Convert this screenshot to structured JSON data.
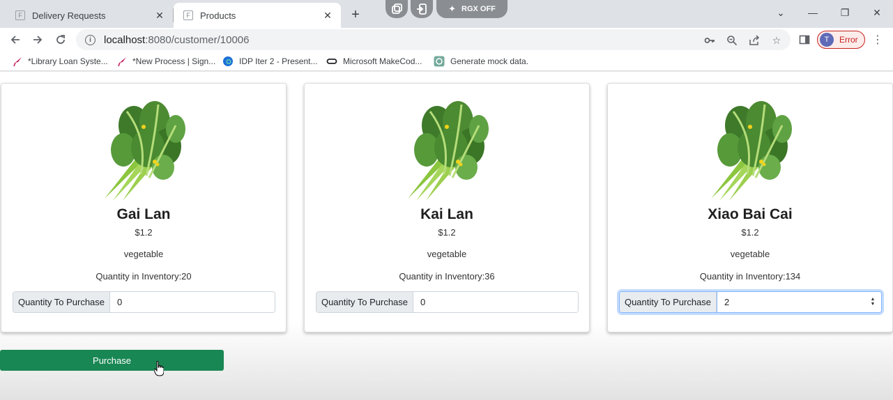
{
  "browser": {
    "tabs": [
      {
        "title": "Delivery Requests",
        "active": false
      },
      {
        "title": "Products",
        "active": true
      }
    ],
    "extension_label": "RGX OFF",
    "url_host": "localhost",
    "url_rest": ":8080/customer/10006",
    "profile_initial": "T",
    "profile_status": "Error",
    "bookmarks": [
      {
        "label": "*Library Loan Syste...",
        "icon": "bird-icon"
      },
      {
        "label": "*New Process | Sign...",
        "icon": "bird-icon"
      },
      {
        "label": "IDP Iter 2 - Present...",
        "icon": "edge-icon"
      },
      {
        "label": "Microsoft MakeCod...",
        "icon": "link-icon"
      },
      {
        "label": "Generate mock data.",
        "icon": "openai-icon"
      }
    ]
  },
  "products": [
    {
      "name": "Gai Lan",
      "price": "$1.2",
      "category": "vegetable",
      "inventory": "Quantity in Inventory:20",
      "qty_label": "Quantity To Purchase",
      "qty_value": "0"
    },
    {
      "name": "Kai Lan",
      "price": "$1.2",
      "category": "vegetable",
      "inventory": "Quantity in Inventory:36",
      "qty_label": "Quantity To Purchase",
      "qty_value": "0"
    },
    {
      "name": "Xiao Bai Cai",
      "price": "$1.2",
      "category": "vegetable",
      "inventory": "Quantity in Inventory:134",
      "qty_label": "Quantity To Purchase",
      "qty_value": "2"
    }
  ],
  "purchase_label": "Purchase",
  "colors": {
    "purchase_button": "#198754",
    "tab_strip": "#dee1e6",
    "focus_ring": "#86b7fe"
  }
}
